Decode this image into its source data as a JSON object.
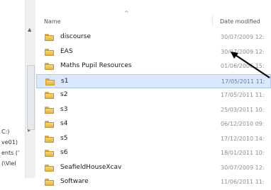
{
  "nav_pane": {
    "items": [
      {
        "label": "C:)"
      },
      {
        "label": "ve01)"
      },
      {
        "label": "ents ('"
      },
      {
        "label": "(\\Viel"
      }
    ]
  },
  "file_list": {
    "columns": {
      "name": "Name",
      "date_modified": "Date modified"
    },
    "rows": [
      {
        "name": "discourse",
        "date": "30/07/2009 12:",
        "icon": "folder-icon"
      },
      {
        "name": "EAS",
        "date": "30/07/2009 12:",
        "icon": "folder-icon"
      },
      {
        "name": "Maths Pupil Resources",
        "date": "01/06/2006 15:",
        "icon": "folder-icon"
      },
      {
        "name": "s1",
        "date": "17/05/2011 11:",
        "icon": "folder-icon",
        "selected": true
      },
      {
        "name": "s2",
        "date": "17/05/2011 11:",
        "icon": "folder-icon"
      },
      {
        "name": "s3",
        "date": "25/03/2011 10:",
        "icon": "folder-icon"
      },
      {
        "name": "s4",
        "date": "06/12/2010 09:",
        "icon": "folder-icon"
      },
      {
        "name": "s5",
        "date": "17/12/2010 14:",
        "icon": "folder-icon"
      },
      {
        "name": "s6",
        "date": "18/01/2011 10:",
        "icon": "folder-icon"
      },
      {
        "name": "SeafieldHouseXcav",
        "date": "30/07/2009 12:",
        "icon": "folder-icon"
      },
      {
        "name": "Software",
        "date": "11/06/2011 11:",
        "icon": "folder-icon"
      }
    ],
    "selected_color": "#d9e8fb"
  }
}
